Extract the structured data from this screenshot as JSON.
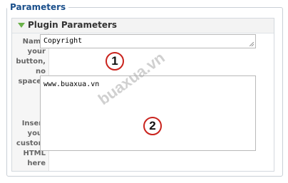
{
  "fieldset": {
    "legend": "Parameters"
  },
  "panel": {
    "title": "Plugin Parameters",
    "toggle_icon": "triangle-down-icon"
  },
  "fields": [
    {
      "label": "Name your button, no spaces",
      "value": "Copyright"
    },
    {
      "label": "Insert your custom HTML here",
      "value": "www.buaxua.vn"
    }
  ],
  "markers": [
    "1",
    "2"
  ],
  "watermark": "buaxua.vn",
  "colors": {
    "legend": "#1a4f8b",
    "marker_border": "#c9231d",
    "toggle": "#6ab24a"
  }
}
